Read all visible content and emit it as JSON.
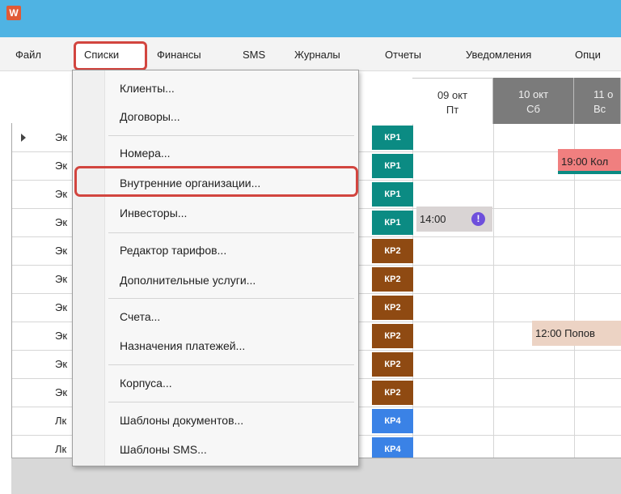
{
  "app": {
    "icon_letter": "W"
  },
  "menubar": {
    "items": [
      {
        "label": "Файл"
      },
      {
        "label": "Списки"
      },
      {
        "label": "Финансы"
      },
      {
        "label": "SMS"
      },
      {
        "label": "Журналы"
      },
      {
        "label": "Отчеты"
      },
      {
        "label": "Уведомления"
      },
      {
        "label": "Опци"
      }
    ]
  },
  "days": [
    {
      "date": "09 окт",
      "weekday": "Пт"
    },
    {
      "date": "10 окт",
      "weekday": "Сб"
    },
    {
      "date": "11 о",
      "weekday": "Вс"
    }
  ],
  "rows": [
    {
      "name": "Эк",
      "kp": "КР1"
    },
    {
      "name": "Эк",
      "kp": "КР1"
    },
    {
      "name": "Эк",
      "kp": "КР1"
    },
    {
      "name": "Эк",
      "kp": "КР1"
    },
    {
      "name": "Эк",
      "kp": "КР2"
    },
    {
      "name": "Эк",
      "kp": "КР2"
    },
    {
      "name": "Эк",
      "kp": "КР2"
    },
    {
      "name": "Эк",
      "kp": "КР2"
    },
    {
      "name": "Эк",
      "kp": "КР2"
    },
    {
      "name": "Эк",
      "kp": "КР2"
    },
    {
      "name": "Лк",
      "kp": "КР4"
    },
    {
      "name": "Лк",
      "kp": "КР4"
    }
  ],
  "bookings": {
    "red": "19:00 Кол",
    "gray": "14:00",
    "tan": "12:00 Попов",
    "alert": "!"
  },
  "dropdown": {
    "items": [
      {
        "label": "Клиенты..."
      },
      {
        "label": "Договоры..."
      },
      {
        "label": "Номера..."
      },
      {
        "label": "Внутренние организации..."
      },
      {
        "label": "Инвесторы..."
      },
      {
        "label": "Редактор тарифов..."
      },
      {
        "label": "Дополнительные услуги..."
      },
      {
        "label": "Счета..."
      },
      {
        "label": "Назначения платежей..."
      },
      {
        "label": "Корпуса..."
      },
      {
        "label": "Шаблоны документов..."
      },
      {
        "label": "Шаблоны SMS..."
      }
    ]
  },
  "colors": {
    "titlebar": "#4fb3e3",
    "highlight": "#d2453f",
    "kp1": "#0b8b83",
    "kp2": "#8f4a12",
    "kp4": "#3a82e6"
  }
}
